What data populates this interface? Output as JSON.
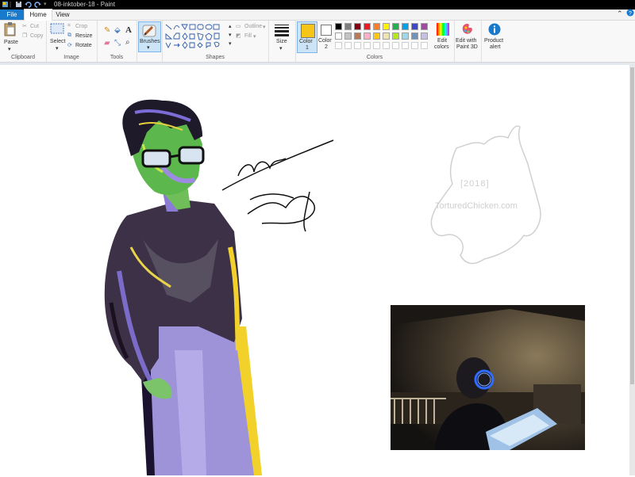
{
  "window": {
    "title": "08-inktober-18 - Paint",
    "separator": "|"
  },
  "tabs": {
    "file": "File",
    "home": "Home",
    "view": "View"
  },
  "window_controls": {
    "minimize": "–",
    "maximize": "☐",
    "close": "✕",
    "chevron": "⌃",
    "help": "?"
  },
  "clipboard": {
    "paste": "Paste",
    "cut": "Cut",
    "copy": "Copy",
    "label": "Clipboard"
  },
  "image": {
    "select": "Select",
    "crop": "Crop",
    "resize": "Resize",
    "rotate": "Rotate",
    "label": "Image"
  },
  "tools": {
    "label": "Tools"
  },
  "brushes": {
    "label": "Brushes"
  },
  "shapes": {
    "outline": "Outline",
    "fill": "Fill",
    "label": "Shapes"
  },
  "size": {
    "label": "Size"
  },
  "colors": {
    "color1_label": "Color",
    "color1_num": "1",
    "color2_label": "Color",
    "color2_num": "2",
    "edit_colors_1": "Edit",
    "edit_colors_2": "colors",
    "label": "Colors",
    "color1_value": "#f5c518",
    "color2_value": "#ffffff",
    "palette_row1": [
      "#000000",
      "#7f7f7f",
      "#880015",
      "#ed1c24",
      "#ff7f27",
      "#fff200",
      "#22b14c",
      "#00a2e8",
      "#3f48cc",
      "#a349a4"
    ],
    "palette_row2": [
      "#ffffff",
      "#c3c3c3",
      "#b97a57",
      "#ffaec9",
      "#ffc90e",
      "#efe4b0",
      "#b5e61d",
      "#99d9ea",
      "#7092be",
      "#c8bfe7"
    ]
  },
  "paint3d": {
    "line1": "Edit with",
    "line2": "Paint 3D"
  },
  "product_alert": {
    "line1": "Product",
    "line2": "alert"
  },
  "watermark": {
    "year": "[2018]",
    "site": "TorturedChicken.com"
  }
}
